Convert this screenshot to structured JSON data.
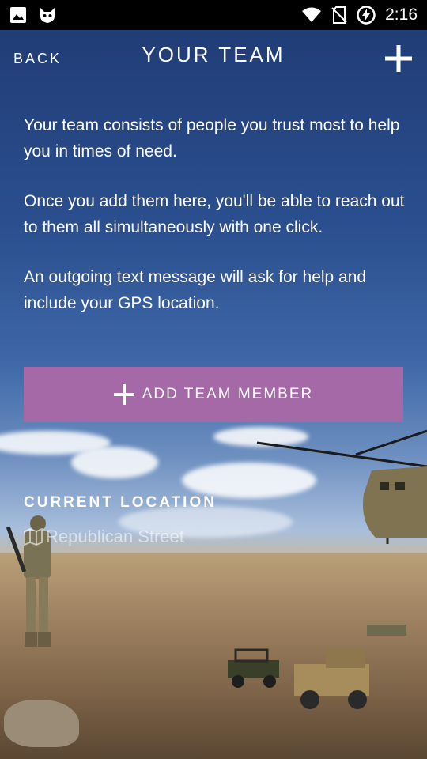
{
  "status_bar": {
    "time": "2:16",
    "icons": [
      "image-icon",
      "cat-icon",
      "wifi-icon",
      "no-sim-icon",
      "battery-charging-icon"
    ]
  },
  "header": {
    "back_label": "BACK",
    "title": "YOUR TEAM",
    "add_icon": "plus-icon"
  },
  "intro": {
    "paragraphs": [
      "Your team consists of people you trust most to help you in times of need.",
      "Once you add them here, you'll be able to reach out to them all simultaneously with one click.",
      "An outgoing text message will ask for help and include your GPS location."
    ]
  },
  "add_member_button": {
    "label": "ADD TEAM MEMBER",
    "icon": "plus-icon",
    "color": "#a569a7"
  },
  "location": {
    "heading": "CURRENT LOCATION",
    "value": "Republican Street",
    "icon": "map-icon"
  }
}
